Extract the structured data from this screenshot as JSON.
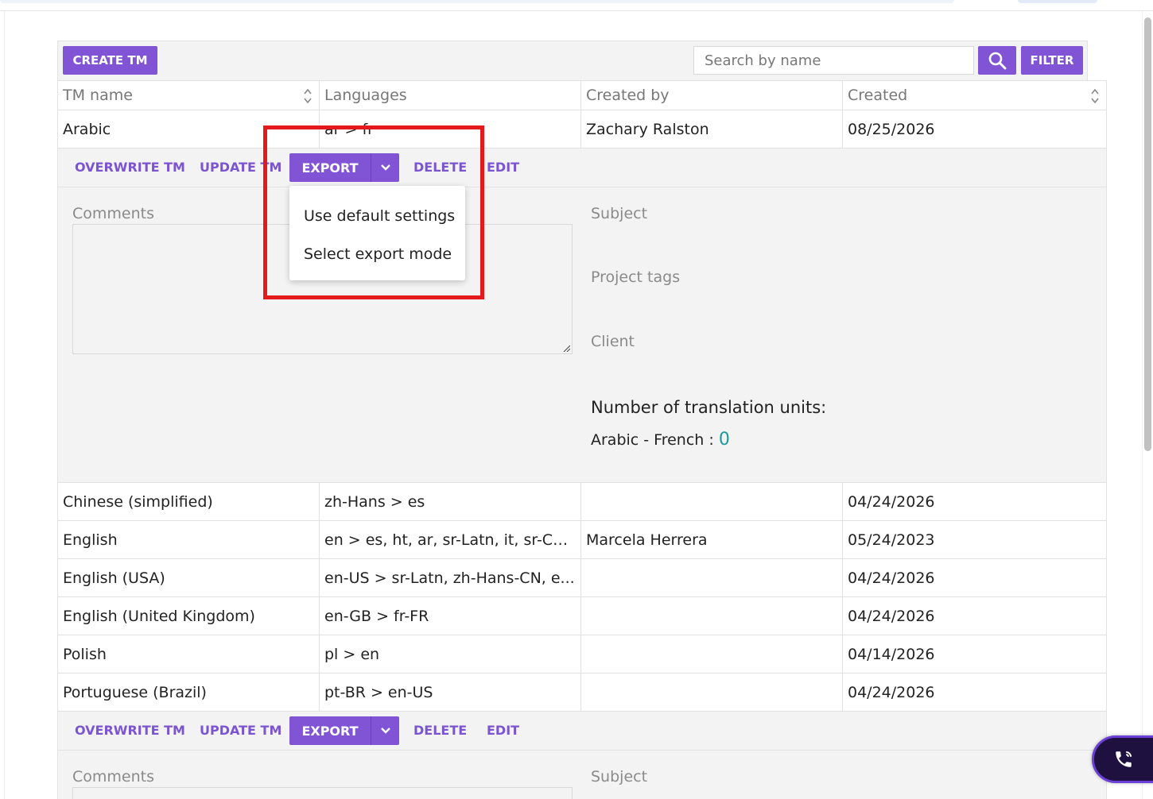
{
  "toolbar": {
    "create_label": "CREATE TM",
    "search_placeholder": "Search by name",
    "filter_label": "FILTER"
  },
  "table": {
    "headers": [
      "TM name",
      "Languages",
      "Created by",
      "Created"
    ],
    "expanded_row": {
      "name": "Arabic",
      "languages": "ar > fr",
      "created_by": "Zachary Ralston",
      "created": "08/25/2026"
    },
    "rows": [
      {
        "name": "Chinese (simplified)",
        "languages": "zh-Hans > es",
        "created_by": "",
        "created": "04/24/2026"
      },
      {
        "name": "English",
        "languages": "en > es, ht, ar, sr-Latn, it, sr-Cyrl...",
        "created_by": "Marcela Herrera",
        "created": "05/24/2023"
      },
      {
        "name": "English (USA)",
        "languages": "en-US > sr-Latn, zh-Hans-CN, e...",
        "created_by": "",
        "created": "04/24/2026"
      },
      {
        "name": "English (United Kingdom)",
        "languages": "en-GB > fr-FR",
        "created_by": "",
        "created": "04/24/2026"
      },
      {
        "name": "Polish",
        "languages": "pl > en",
        "created_by": "",
        "created": "04/14/2026"
      },
      {
        "name": "Portuguese (Brazil)",
        "languages": "pt-BR > en-US",
        "created_by": "",
        "created": "04/24/2026"
      }
    ]
  },
  "actions": {
    "overwrite": "OVERWRITE TM",
    "update": "UPDATE TM",
    "export": "EXPORT",
    "delete": "DELETE",
    "edit": "EDIT"
  },
  "details": {
    "comments_label": "Comments",
    "subject_label": "Subject",
    "project_tags_label": "Project tags",
    "client_label": "Client",
    "units_title": "Number of translation units:",
    "units_pair": "Arabic - French : ",
    "units_count": "0"
  },
  "export_menu": {
    "items": [
      "Use default settings",
      "Select export mode"
    ]
  },
  "colors": {
    "accent": "#8154d6",
    "highlight": "#e3191c",
    "count": "#1a9a9a"
  }
}
